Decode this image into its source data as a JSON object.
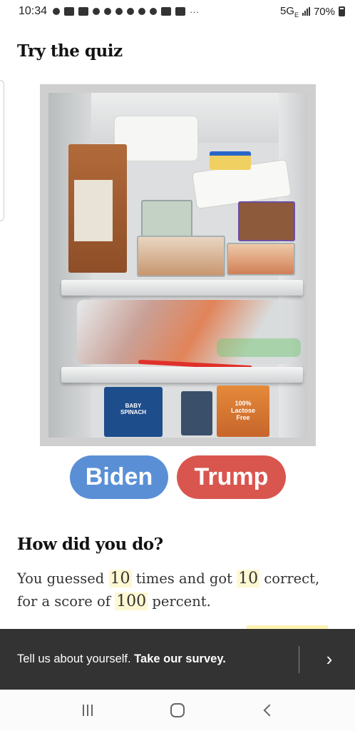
{
  "status_bar": {
    "time": "10:34",
    "more": "···",
    "network": "5G",
    "network_sub": "E",
    "battery": "70%"
  },
  "quiz": {
    "title": "Try the quiz",
    "photo_package_labels": [
      "100%",
      "Lactose",
      "Free",
      "BABY",
      "SPINACH"
    ],
    "buttons": {
      "biden": "Biden",
      "trump": "Trump"
    },
    "colors": {
      "biden": "#5a8fd6",
      "trump": "#d9564f"
    }
  },
  "results": {
    "title": "How did you do?",
    "t1": "You guessed ",
    "guessed": "10",
    "t2": " times and got ",
    "correct": "10",
    "t3": " correct, for a score of ",
    "score": "100",
    "t4": " percent."
  },
  "survey": {
    "text": "Tell us about yourself. ",
    "cta": "Take our survey.",
    "arrow": "›"
  }
}
